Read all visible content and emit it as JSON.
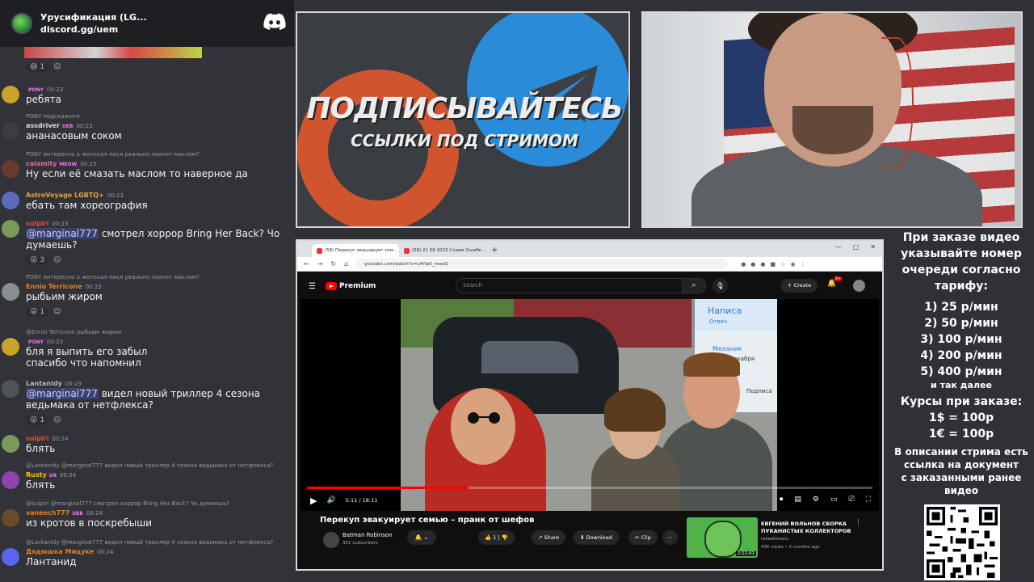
{
  "discord": {
    "server_name": "Урусификация (LG...",
    "invite": "discord.gg/uem",
    "top_reactions": [
      "1"
    ],
    "messages": [
      {
        "user": "",
        "badge": "PONY",
        "time": "00:23",
        "text": "ребята",
        "color": "#b5bac1",
        "avatar": "#c9a227"
      },
      {
        "reply": "PONY подскажите",
        "user": "assdriver",
        "badge": "UEB",
        "time": "00:23",
        "text": "ананасовым соком",
        "color": "#dbdee1",
        "avatar": "#3a3c40"
      },
      {
        "reply": "PONY интересно а женская пися реально пахнет маслом?",
        "user": "calamity",
        "badge": "MEOW",
        "time": "00:23",
        "text": "Ну если её смазать маслом то наверное да",
        "color": "#e06c9f",
        "avatar": "#6b3a2e"
      },
      {
        "user": "AstroVoyage LGBTQ+",
        "badge": "",
        "time": "00:23",
        "text": "ебать там хореография",
        "color": "#e6a23c",
        "avatar": "#5b6bbf"
      },
      {
        "user": "sulpiri",
        "badge": "",
        "time": "00:23",
        "mention": "@marginal777",
        "text": " смотрел хоррор Bring Her Back? Чо думаешь?",
        "color": "#e74c3c",
        "avatar": "#7a9a5a",
        "reactions": [
          "3"
        ]
      },
      {
        "reply": "PONY интересно а женская пися реально пахнет маслом?",
        "user": "Ennio Terricone",
        "badge": "",
        "time": "00:23",
        "text": "рыбьим жиром",
        "color": "#e67e22",
        "avatar": "#8a8e93",
        "reactions": [
          "1"
        ]
      },
      {
        "reply": "@Ennio Terricone рыбьим жиром",
        "user": "",
        "badge": "PONY",
        "time": "00:23",
        "text": "бля я выпить его забыл\nспасибо что напомнил",
        "color": "#b5bac1",
        "avatar": "#c9a227"
      },
      {
        "user": "Lantanidy",
        "badge": "",
        "time": "00:23",
        "mention": "@marginal777",
        "text": " видел новый триллер 4 сезона ведьмака от нетфлекса?",
        "color": "#b5bac1",
        "avatar": "#505459",
        "reactions": [
          "1"
        ]
      },
      {
        "user": "sulpiri",
        "badge": "",
        "time": "00:24",
        "text": "блять",
        "color": "#e74c3c",
        "avatar": "#7a9a5a"
      },
      {
        "reply": "@Lantanidy @marginal777 видел новый триллер 4 сезона ведьмака от нетфлекса?",
        "user": "Rusty",
        "badge": "UA",
        "time": "00:24",
        "text": "блять",
        "color": "#f1c40f",
        "avatar": "#8e44ad"
      },
      {
        "reply": "@sulpiri @marginal777 смотрел хоррор Bring Her Back? Чо думаешь?",
        "user": "vaneech777",
        "badge": "UEB",
        "time": "00:24",
        "text": "из кротов в поскребыши",
        "color": "#e67e22",
        "avatar": "#6a4a2a"
      },
      {
        "reply": "@Lantanidy @marginal777 видел новый триллер 4 сезона ведьмака от нетфлекса?",
        "user": "Дядюшка Мицуке",
        "badge": "",
        "time": "00:24",
        "text": "Лантанид",
        "color": "#e67e22",
        "avatar": "#5865f2"
      }
    ]
  },
  "banner": {
    "title": "ПОДПИСЫВАЙТЕСЬ",
    "subtitle": "ССЫЛКИ ПОД СТРИМОМ"
  },
  "browser": {
    "tabs": [
      "(58) Перекуп эвакуирует сем...",
      "(58) 21 08 2023 Стрим Ошибк..."
    ],
    "url": "youtube.com/watch?v=L4Yip0_mwzQ",
    "yt_logo": "Premium",
    "search_placeholder": "Search",
    "create_label": "Create",
    "notif_count": "9+",
    "player_time": "5:11 / 18:11",
    "progress": 0.285,
    "video_title": "Перекуп эвакуирует семью – пранк от шефов",
    "channel": "Batman Robinson",
    "subscribers": "351 subscribers",
    "likes": "1",
    "actions": [
      "Share",
      "Download",
      "Clip"
    ],
    "overlay": {
      "header": "Написа",
      "subheader": "Отвеч",
      "mechanic": "Механик",
      "since": "вито с декабря",
      "sign": "Подписа"
    },
    "recommended": {
      "title": "ЕВГЕНИЙ ВОЛЬНОВ СБОРКА ПУКАНИСТЫХ КОЛЛЕКТОРОВ",
      "channel": "takeshimaru",
      "meta": "43K views • 2 months ago",
      "duration": "2:12:41"
    }
  },
  "pricing": {
    "heading": [
      "При заказе видео",
      "указывайте номер",
      "очереди согласно",
      "тарифу:"
    ],
    "tiers": [
      "1) 25 р/мин",
      "2) 50 р/мин",
      "3) 100 р/мин",
      "4) 200 р/мин",
      "5) 400 р/мин"
    ],
    "etc": "и так далее",
    "courses_title": "Курсы при заказе:",
    "courses": [
      "1$ = 100р",
      "1€ = 100р"
    ],
    "note": [
      "В описании стрима есть",
      "ссылка на документ",
      "с заказанными ранее",
      "видео"
    ]
  }
}
